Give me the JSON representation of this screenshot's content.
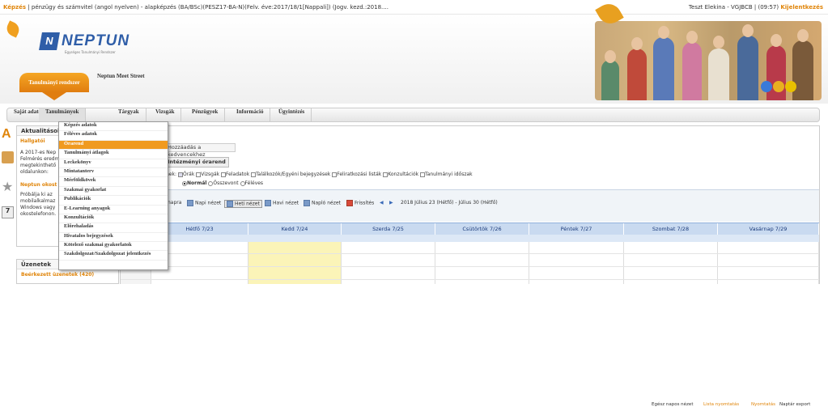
{
  "topbar": {
    "training_label": "Képzés",
    "training_text": " | pénzügy és számvitel (angol nyelven) - alapképzés (BA/BSc)(PESZ17-BA-N)(Felv. éve:2017/18/1[Nappali]) (Jogv. kezd.:2018....",
    "user": "Teszt Elekina - VGJBCB",
    "timer": "(09:57)",
    "logout": "Kijelentkezés"
  },
  "logo": {
    "name": "NEPTUN",
    "subtitle": "Egységes Tanulmányi Rendszer"
  },
  "tabs": {
    "active": "Tanulmányi rendszer",
    "second": "Neptun Meet Street"
  },
  "menu": [
    "Saját adatok",
    "Tanulmányok",
    "Tárgyak",
    "Vizsgák",
    "Pénzügyek",
    "Információ",
    "Ügyintézés"
  ],
  "dropdown": {
    "items": [
      "Képzés adatok",
      "Féléves adatok",
      "Órarend",
      "Tanulmányi átlagok",
      "Leckekönyv",
      "Mintatanterv",
      "Mérföldkövek",
      "Szakmai gyakorlat",
      "Publikációk",
      "E-Learning anyagok",
      "Konzultációk",
      "Előrehaladás",
      "Hivatalos bejegyzések",
      "Kötelező szakmai gyakorlatok",
      "Szakdolgozat/Szakdolgozat jelentkezés"
    ],
    "selected_index": 2
  },
  "panel": {
    "title": "Aktualitások",
    "alert_title": "Hallgatói",
    "text1": "A 2017-es Nep",
    "text2": "Felmérés eredm",
    "text3": "megtekinthető",
    "text4": "oldalunkon:",
    "link_title": "Neptun okost",
    "text5": "Próbálja ki az",
    "text6": "mobilalkalmaz",
    "text7": "Windows vagy",
    "text8": "okostelefonon."
  },
  "messages": {
    "title": "Üzenetek",
    "inbox": "Beérkezett üzenetek (420)"
  },
  "content": {
    "favorites": "Hozzáadás a kedvencekhez",
    "institutional": "Intézményi órarend",
    "filter_prefix": "mek:",
    "filters": [
      {
        "label": "Órák",
        "checked": true
      },
      {
        "label": "Vizsgák",
        "checked": false
      },
      {
        "label": "Feladatok",
        "checked": false
      },
      {
        "label": "Találkozók/Egyéni bejegyzések",
        "checked": false
      },
      {
        "label": "Feliratkozási listák",
        "checked": false
      },
      {
        "label": "Konzultációk",
        "checked": false
      },
      {
        "label": "Tanulmányi időszak",
        "checked": false
      }
    ],
    "radios": [
      {
        "label": "Normál",
        "checked": true
      },
      {
        "label": "Összevont",
        "checked": false
      },
      {
        "label": "Féléves",
        "checked": false
      }
    ]
  },
  "toolbar": {
    "napra": "napra",
    "daily": "Napi nézet",
    "weekly": "Heti nézet",
    "monthly": "Havi nézet",
    "log": "Napló nézet",
    "refresh": "Frissítés",
    "range": "2018 Július 23 (Hétfő) - Július 30 (Hétfő)",
    "fullday": "Egész napos nézet",
    "list_print": "Lista nyomtatás",
    "print": "Nyomtatás",
    "export": "Naptár export"
  },
  "days": [
    "Hétfő 7/23",
    "Kedd 7/24",
    "Szerda 7/25",
    "Csütörtök 7/26",
    "Péntek 7/27",
    "Szombat 7/28",
    "Vasárnap 7/29"
  ],
  "colors": {
    "orange": "#f09a20",
    "blue": "#2f5ea8",
    "calendar_header": "#c9daf0",
    "today": "#fbf4b8"
  }
}
